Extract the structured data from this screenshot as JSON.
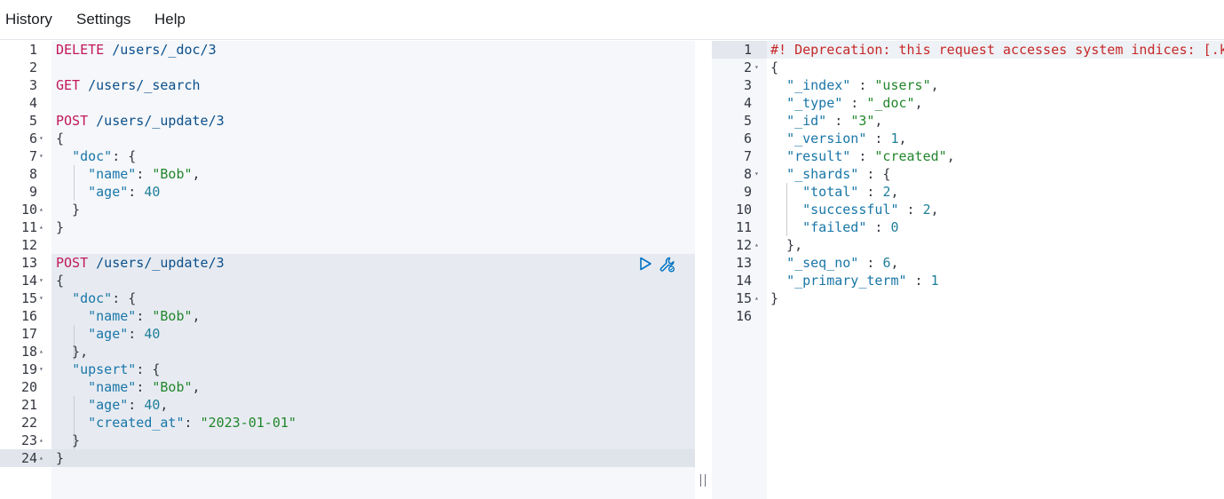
{
  "menu": {
    "history": "History",
    "settings": "Settings",
    "help": "Help"
  },
  "request_editor": {
    "lines": [
      {
        "n": "1",
        "fold": "",
        "segs": [
          [
            "method",
            "DELETE"
          ],
          [
            "url",
            " /users/_doc/3"
          ]
        ]
      },
      {
        "n": "2",
        "fold": "",
        "segs": []
      },
      {
        "n": "3",
        "fold": "",
        "segs": [
          [
            "method",
            "GET"
          ],
          [
            "url",
            " /users/_search"
          ]
        ]
      },
      {
        "n": "4",
        "fold": "",
        "segs": []
      },
      {
        "n": "5",
        "fold": "",
        "segs": [
          [
            "method",
            "POST"
          ],
          [
            "url",
            " /users/_update/3"
          ]
        ]
      },
      {
        "n": "6",
        "fold": "▾",
        "segs": [
          [
            "punct",
            "{"
          ]
        ]
      },
      {
        "n": "7",
        "fold": "▾",
        "segs": [
          [
            "punct",
            "  "
          ],
          [
            "key",
            "\"doc\""
          ],
          [
            "punct",
            ": {"
          ]
        ]
      },
      {
        "n": "8",
        "fold": "",
        "segs": [
          [
            "punct",
            "    "
          ],
          [
            "key",
            "\"name\""
          ],
          [
            "punct",
            ": "
          ],
          [
            "str",
            "\"Bob\""
          ],
          [
            "punct",
            ","
          ]
        ]
      },
      {
        "n": "9",
        "fold": "",
        "segs": [
          [
            "punct",
            "    "
          ],
          [
            "key",
            "\"age\""
          ],
          [
            "punct",
            ": "
          ],
          [
            "num",
            "40"
          ]
        ]
      },
      {
        "n": "10",
        "fold": "▴",
        "segs": [
          [
            "punct",
            "  }"
          ]
        ]
      },
      {
        "n": "11",
        "fold": "▴",
        "segs": [
          [
            "punct",
            "}"
          ]
        ]
      },
      {
        "n": "12",
        "fold": "",
        "segs": []
      },
      {
        "n": "13",
        "fold": "",
        "segs": [
          [
            "method",
            "POST"
          ],
          [
            "url",
            " /users/_update/3"
          ]
        ]
      },
      {
        "n": "14",
        "fold": "▾",
        "segs": [
          [
            "punct",
            "{"
          ]
        ]
      },
      {
        "n": "15",
        "fold": "▾",
        "segs": [
          [
            "punct",
            "  "
          ],
          [
            "key",
            "\"doc\""
          ],
          [
            "punct",
            ": {"
          ]
        ]
      },
      {
        "n": "16",
        "fold": "",
        "segs": [
          [
            "punct",
            "    "
          ],
          [
            "key",
            "\"name\""
          ],
          [
            "punct",
            ": "
          ],
          [
            "str",
            "\"Bob\""
          ],
          [
            "punct",
            ","
          ]
        ]
      },
      {
        "n": "17",
        "fold": "",
        "segs": [
          [
            "punct",
            "    "
          ],
          [
            "key",
            "\"age\""
          ],
          [
            "punct",
            ": "
          ],
          [
            "num",
            "40"
          ]
        ]
      },
      {
        "n": "18",
        "fold": "▴",
        "segs": [
          [
            "punct",
            "  },"
          ]
        ]
      },
      {
        "n": "19",
        "fold": "▾",
        "segs": [
          [
            "punct",
            "  "
          ],
          [
            "key",
            "\"upsert\""
          ],
          [
            "punct",
            ": {"
          ]
        ]
      },
      {
        "n": "20",
        "fold": "",
        "segs": [
          [
            "punct",
            "    "
          ],
          [
            "key",
            "\"name\""
          ],
          [
            "punct",
            ": "
          ],
          [
            "str",
            "\"Bob\""
          ],
          [
            "punct",
            ","
          ]
        ]
      },
      {
        "n": "21",
        "fold": "",
        "segs": [
          [
            "punct",
            "    "
          ],
          [
            "key",
            "\"age\""
          ],
          [
            "punct",
            ": "
          ],
          [
            "num",
            "40"
          ],
          [
            "punct",
            ","
          ]
        ]
      },
      {
        "n": "22",
        "fold": "",
        "segs": [
          [
            "punct",
            "    "
          ],
          [
            "key",
            "\"created_at\""
          ],
          [
            "punct",
            ": "
          ],
          [
            "str",
            "\"2023-01-01\""
          ]
        ]
      },
      {
        "n": "23",
        "fold": "▴",
        "segs": [
          [
            "punct",
            "  }"
          ]
        ]
      },
      {
        "n": "24",
        "fold": "▴",
        "segs": [
          [
            "punct",
            "}"
          ]
        ]
      }
    ],
    "actions": {
      "run": "play-icon",
      "settings": "wrench-icon"
    }
  },
  "response_viewer": {
    "lines": [
      {
        "n": "1",
        "fold": "",
        "segs": [
          [
            "warn",
            "#! Deprecation: this request accesses system indices: [.kibana"
          ]
        ]
      },
      {
        "n": "2",
        "fold": "▾",
        "segs": [
          [
            "punct",
            "{"
          ]
        ]
      },
      {
        "n": "3",
        "fold": "",
        "segs": [
          [
            "punct",
            "  "
          ],
          [
            "key",
            "\"_index\""
          ],
          [
            "punct",
            " : "
          ],
          [
            "str",
            "\"users\""
          ],
          [
            "punct",
            ","
          ]
        ]
      },
      {
        "n": "4",
        "fold": "",
        "segs": [
          [
            "punct",
            "  "
          ],
          [
            "key",
            "\"_type\""
          ],
          [
            "punct",
            " : "
          ],
          [
            "str",
            "\"_doc\""
          ],
          [
            "punct",
            ","
          ]
        ]
      },
      {
        "n": "5",
        "fold": "",
        "segs": [
          [
            "punct",
            "  "
          ],
          [
            "key",
            "\"_id\""
          ],
          [
            "punct",
            " : "
          ],
          [
            "str",
            "\"3\""
          ],
          [
            "punct",
            ","
          ]
        ]
      },
      {
        "n": "6",
        "fold": "",
        "segs": [
          [
            "punct",
            "  "
          ],
          [
            "key",
            "\"_version\""
          ],
          [
            "punct",
            " : "
          ],
          [
            "num",
            "1"
          ],
          [
            "punct",
            ","
          ]
        ]
      },
      {
        "n": "7",
        "fold": "",
        "segs": [
          [
            "punct",
            "  "
          ],
          [
            "key",
            "\"result\""
          ],
          [
            "punct",
            " : "
          ],
          [
            "str",
            "\"created\""
          ],
          [
            "punct",
            ","
          ]
        ]
      },
      {
        "n": "8",
        "fold": "▾",
        "segs": [
          [
            "punct",
            "  "
          ],
          [
            "key",
            "\"_shards\""
          ],
          [
            "punct",
            " : {"
          ]
        ]
      },
      {
        "n": "9",
        "fold": "",
        "segs": [
          [
            "punct",
            "    "
          ],
          [
            "key",
            "\"total\""
          ],
          [
            "punct",
            " : "
          ],
          [
            "num",
            "2"
          ],
          [
            "punct",
            ","
          ]
        ]
      },
      {
        "n": "10",
        "fold": "",
        "segs": [
          [
            "punct",
            "    "
          ],
          [
            "key",
            "\"successful\""
          ],
          [
            "punct",
            " : "
          ],
          [
            "num",
            "2"
          ],
          [
            "punct",
            ","
          ]
        ]
      },
      {
        "n": "11",
        "fold": "",
        "segs": [
          [
            "punct",
            "    "
          ],
          [
            "key",
            "\"failed\""
          ],
          [
            "punct",
            " : "
          ],
          [
            "num",
            "0"
          ]
        ]
      },
      {
        "n": "12",
        "fold": "▴",
        "segs": [
          [
            "punct",
            "  },"
          ]
        ]
      },
      {
        "n": "13",
        "fold": "",
        "segs": [
          [
            "punct",
            "  "
          ],
          [
            "key",
            "\"_seq_no\""
          ],
          [
            "punct",
            " : "
          ],
          [
            "num",
            "6"
          ],
          [
            "punct",
            ","
          ]
        ]
      },
      {
        "n": "14",
        "fold": "",
        "segs": [
          [
            "punct",
            "  "
          ],
          [
            "key",
            "\"_primary_term\""
          ],
          [
            "punct",
            " : "
          ],
          [
            "num",
            "1"
          ]
        ]
      },
      {
        "n": "15",
        "fold": "▴",
        "segs": [
          [
            "punct",
            "}"
          ]
        ]
      },
      {
        "n": "16",
        "fold": "",
        "segs": []
      }
    ]
  },
  "colors": {
    "method": "#c2185b",
    "url": "#0b4f8a",
    "key": "#1976a8",
    "string": "#22862c",
    "number": "#1f7f99",
    "warning": "#c62828"
  }
}
